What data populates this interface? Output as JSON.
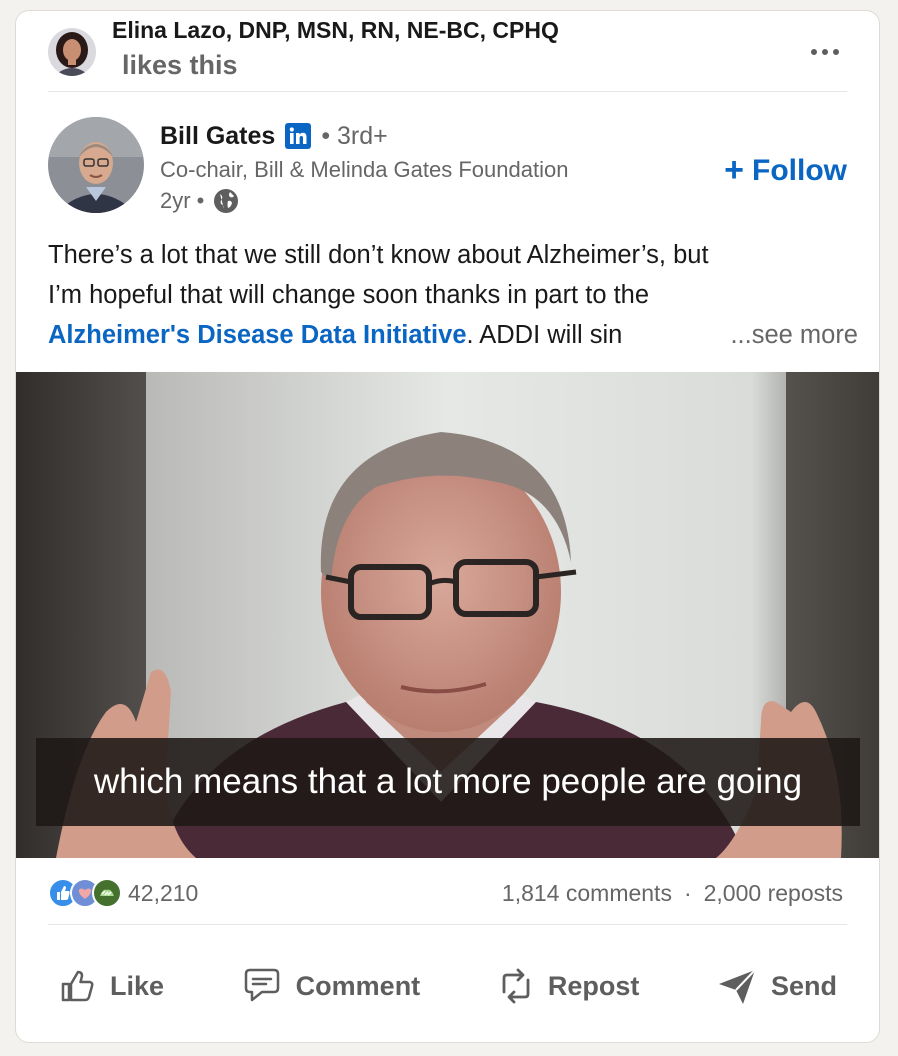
{
  "social_context": {
    "actor_name": "Elina Lazo, DNP, MSN, RN, NE-BC, CPHQ",
    "action": "likes this",
    "more_icon": "ellipsis-icon"
  },
  "author": {
    "name": "Bill Gates",
    "badge": "linkedin-icon",
    "degree": "• 3rd+",
    "headline": "Co-chair, Bill & Melinda Gates Foundation",
    "time": "2yr •",
    "visibility_icon": "globe-icon"
  },
  "follow": {
    "label": "Follow",
    "icon": "plus-icon"
  },
  "post": {
    "line1": "There’s a lot that we still don’t know about Alzheimer’s, but",
    "line2": "I’m hopeful that will change soon thanks in part to the",
    "link": "Alzheimer's Disease Data Initiative",
    "line3_rest": ". ADDI will sin",
    "see_more": "...see more"
  },
  "video": {
    "caption": "which means that a lot more people are going"
  },
  "counts": {
    "reactions": "42,210",
    "comments": "1,814 comments",
    "separator": "·",
    "reposts": "2,000 reposts",
    "reaction_icons": [
      "like-reaction-icon",
      "love-reaction-icon",
      "support-reaction-icon"
    ]
  },
  "actions": {
    "like": "Like",
    "comment": "Comment",
    "repost": "Repost",
    "send": "Send"
  },
  "colors": {
    "brand_blue": "#0a66c2",
    "text_primary": "#191919",
    "text_secondary": "#666666",
    "page_bg": "#f4f2ee"
  }
}
